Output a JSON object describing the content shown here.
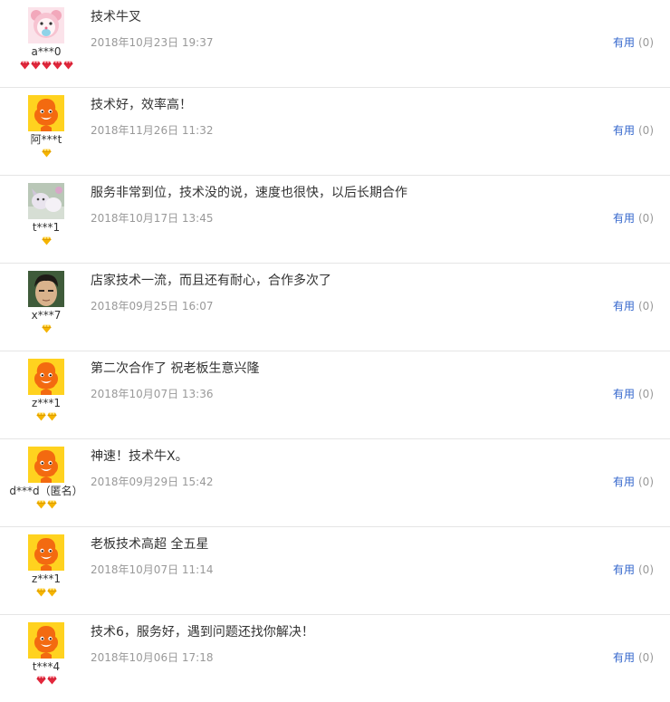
{
  "colors": {
    "link": "#3366cc",
    "muted": "#999999",
    "divider": "#e5e5e5",
    "diamond_red": "#e3273b",
    "diamond_gold": "#f5b400"
  },
  "reviews": [
    {
      "avatar": "avatar-pink-bear",
      "user": "a***0",
      "badge_type": "red-diamond",
      "badge_count": 5,
      "text": "技术牛叉",
      "time": "2018年10月23日 19:37",
      "useful_label": "有用",
      "useful_count": "(0)"
    },
    {
      "avatar": "avatar-orange-mascot",
      "user": "阿***t",
      "badge_type": "gold-diamond",
      "badge_count": 1,
      "text": "技术好，效率高！",
      "time": "2018年11月26日 11:32",
      "useful_label": "有用",
      "useful_count": "(0)"
    },
    {
      "avatar": "avatar-photo-pets",
      "user": "t***1",
      "badge_type": "gold-diamond",
      "badge_count": 1,
      "text": "服务非常到位，技术没的说，速度也很快，以后长期合作",
      "time": "2018年10月17日 13:45",
      "useful_label": "有用",
      "useful_count": "(0)"
    },
    {
      "avatar": "avatar-photo-person",
      "user": "x***7",
      "badge_type": "gold-diamond",
      "badge_count": 1,
      "text": "店家技术一流，而且还有耐心，合作多次了",
      "time": "2018年09月25日 16:07",
      "useful_label": "有用",
      "useful_count": "(0)"
    },
    {
      "avatar": "avatar-orange-mascot",
      "user": "z***1",
      "badge_type": "gold-diamond",
      "badge_count": 2,
      "text": "第二次合作了 祝老板生意兴隆",
      "time": "2018年10月07日 13:36",
      "useful_label": "有用",
      "useful_count": "(0)"
    },
    {
      "avatar": "avatar-orange-mascot",
      "user": "d***d（匿名）",
      "badge_type": "gold-diamond",
      "badge_count": 2,
      "text": "神速！技术牛X。",
      "time": "2018年09月29日 15:42",
      "useful_label": "有用",
      "useful_count": "(0)"
    },
    {
      "avatar": "avatar-orange-mascot",
      "user": "z***1",
      "badge_type": "gold-diamond",
      "badge_count": 2,
      "text": "老板技术高超 全五星",
      "time": "2018年10月07日 11:14",
      "useful_label": "有用",
      "useful_count": "(0)"
    },
    {
      "avatar": "avatar-orange-mascot",
      "user": "t***4",
      "badge_type": "red-diamond",
      "badge_count": 2,
      "text": "技术6，服务好，遇到问题还找你解决！",
      "time": "2018年10月06日 17:18",
      "useful_label": "有用",
      "useful_count": "(0)"
    }
  ]
}
